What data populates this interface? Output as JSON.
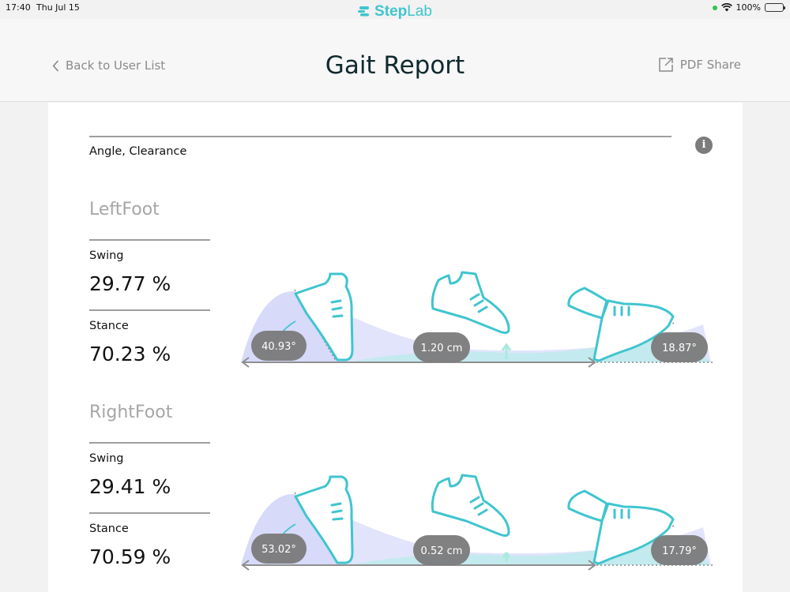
{
  "status": {
    "time": "17:40",
    "date": "Thu Jul 15",
    "battery": "100%"
  },
  "brand": {
    "step": "Step",
    "lab": "Lab",
    "color": "#3fc5cf"
  },
  "nav": {
    "back_label": "Back to User List",
    "title": "Gait Report",
    "share_label": "PDF Share"
  },
  "section": {
    "subtitle": "Angle, Clearance"
  },
  "feet": [
    {
      "name": "LeftFoot",
      "swing_label": "Swing",
      "swing_value": "29.77 %",
      "stance_label": "Stance",
      "stance_value": "70.23 %",
      "heel_angle": "40.93°",
      "clearance": "1.20 cm",
      "toe_angle": "18.87°"
    },
    {
      "name": "RightFoot",
      "swing_label": "Swing",
      "swing_value": "29.41 %",
      "stance_label": "Stance",
      "stance_value": "70.59 %",
      "heel_angle": "53.02°",
      "clearance": "0.52 cm",
      "toe_angle": "17.79°"
    }
  ],
  "colors": {
    "accent": "#3fc5cf",
    "pill": "#7a7a7a",
    "lavender": "#c9cdf7"
  }
}
